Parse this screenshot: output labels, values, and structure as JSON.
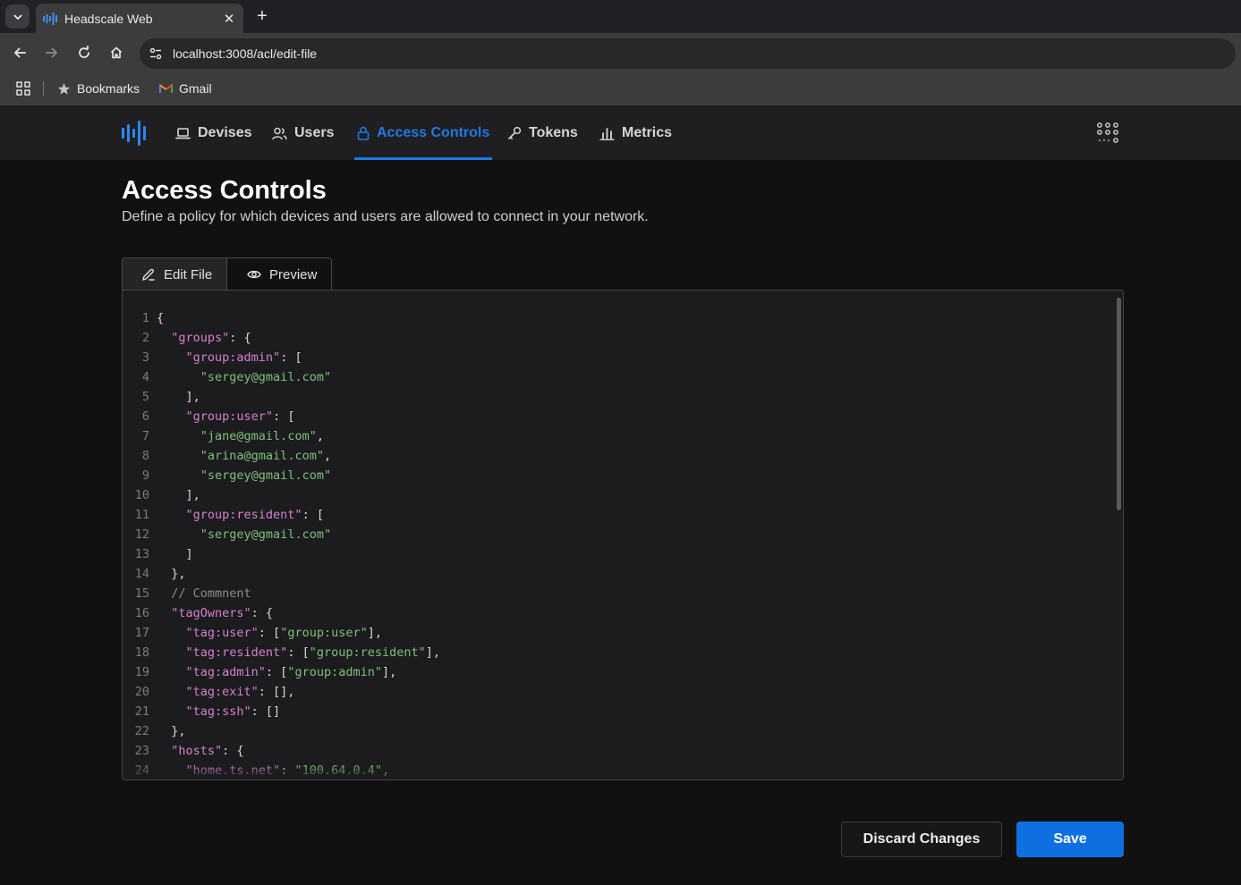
{
  "browser": {
    "tab_title": "Headscale Web",
    "url": "localhost:3008/acl/edit-file",
    "bookmarks": [
      {
        "label": "Bookmarks",
        "icon": "star-icon"
      },
      {
        "label": "Gmail",
        "icon": "gmail-icon"
      }
    ]
  },
  "nav": {
    "items": [
      {
        "label": "Devises",
        "icon": "laptop-icon"
      },
      {
        "label": "Users",
        "icon": "users-icon"
      },
      {
        "label": "Access Controls",
        "icon": "lock-icon",
        "active": true
      },
      {
        "label": "Tokens",
        "icon": "key-icon"
      },
      {
        "label": "Metrics",
        "icon": "bar-chart-icon"
      }
    ],
    "accent_color": "#1f7ae6"
  },
  "page": {
    "title": "Access Controls",
    "description": "Define a policy for which devices and users are allowed to connect in your network."
  },
  "tabs": {
    "edit": "Edit File",
    "preview": "Preview"
  },
  "editor": {
    "lines": [
      {
        "n": "1",
        "code": "{"
      },
      {
        "n": "2",
        "code": "  \"groups\": {"
      },
      {
        "n": "3",
        "code": "    \"group:admin\": ["
      },
      {
        "n": "4",
        "code": "      \"sergey@gmail.com\""
      },
      {
        "n": "5",
        "code": "    ],"
      },
      {
        "n": "6",
        "code": "    \"group:user\": ["
      },
      {
        "n": "7",
        "code": "      \"jane@gmail.com\","
      },
      {
        "n": "8",
        "code": "      \"arina@gmail.com\","
      },
      {
        "n": "9",
        "code": "      \"sergey@gmail.com\""
      },
      {
        "n": "10",
        "code": "    ],"
      },
      {
        "n": "11",
        "code": "    \"group:resident\": ["
      },
      {
        "n": "12",
        "code": "      \"sergey@gmail.com\""
      },
      {
        "n": "13",
        "code": "    ]"
      },
      {
        "n": "14",
        "code": "  },"
      },
      {
        "n": "15",
        "code": "  // Commnent"
      },
      {
        "n": "16",
        "code": "  \"tagOwners\": {"
      },
      {
        "n": "17",
        "code": "    \"tag:user\": [\"group:user\"],"
      },
      {
        "n": "18",
        "code": "    \"tag:resident\": [\"group:resident\"],"
      },
      {
        "n": "19",
        "code": "    \"tag:admin\": [\"group:admin\"],"
      },
      {
        "n": "20",
        "code": "    \"tag:exit\": [],"
      },
      {
        "n": "21",
        "code": "    \"tag:ssh\": []"
      },
      {
        "n": "22",
        "code": "  },"
      },
      {
        "n": "23",
        "code": "  \"hosts\": {"
      },
      {
        "n": "24",
        "code": "    \"home.ts.net\": \"100.64.0.4\","
      }
    ],
    "key_color": "#d67fd0",
    "string_color": "#7fc07a",
    "comment_color": "#8d8d8d"
  },
  "actions": {
    "discard": "Discard Changes",
    "save": "Save"
  }
}
